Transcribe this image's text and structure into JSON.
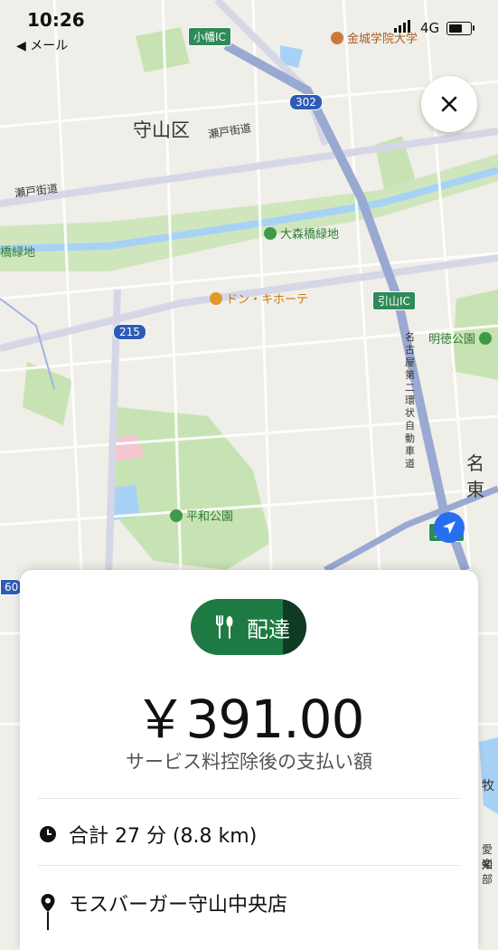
{
  "status_bar": {
    "time": "10:26",
    "back_label": "◀ メール",
    "network": "4G"
  },
  "map": {
    "labels": {
      "ward": "守山区",
      "street_seto1": "瀬戸街道",
      "street_seto2": "瀬戸街道",
      "park_omori": "大森橋緑地",
      "park_left": "橋緑地",
      "store": "ドン・キホーテ",
      "ic_obata": "小幡IC",
      "ic_hikiyama": "引山IC",
      "ic_kami": "上",
      "ic_kami2": "IC",
      "route302": "302",
      "route215": "215",
      "route60": "60",
      "university": "金城学院大学",
      "park_meitoku": "明徳公園",
      "park_heiwa": "平和公園",
      "expressway": "名古屋第二環状自動車道",
      "meito": "名東",
      "right_edge1": "牧",
      "right_edge2": "愛知",
      "right_edge3": "楽部"
    }
  },
  "card": {
    "mode_label": "配達",
    "amount": "￥391.00",
    "caption": "サービス料控除後の支払い額",
    "duration": "合計 27 分 (8.8 km)",
    "pickup": "モスバーガー守山中央店"
  },
  "colors": {
    "accent_green": "#1d7a43",
    "dark_green": "#0e3b22",
    "map_bg": "#efeee8",
    "park": "#c8e3b3",
    "river": "#a8d2f5",
    "expressway": "#9aa9d1",
    "pin_blue": "#276ef1"
  }
}
